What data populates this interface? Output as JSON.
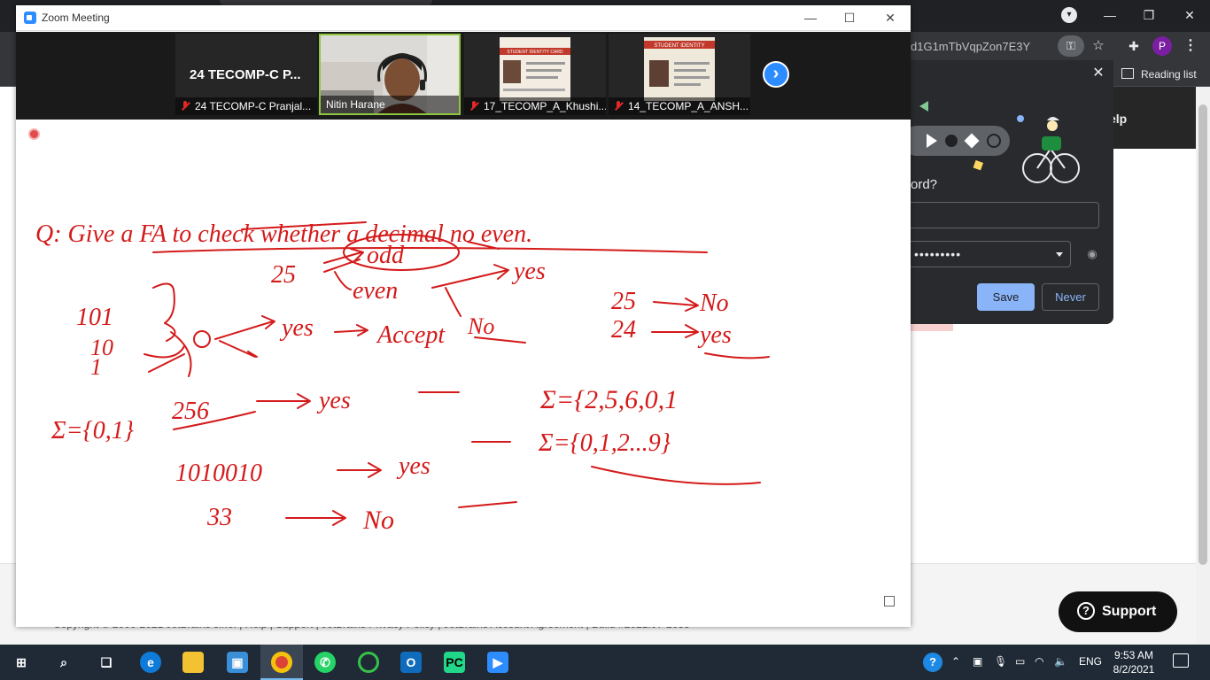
{
  "chrome": {
    "url_fragment": "d1G1mTbVqpZon7E3Y",
    "reading_list": "Reading list",
    "help_fragment": "elp",
    "avatar_letter": "P",
    "footer_text": "Copyright © 2000-2021 JetBrains s.r.o. | Help | Support | JetBrains Privacy Policy | JetBrains Account Agreement | Build #2021.07-2055"
  },
  "password_bubble": {
    "question_fragment": "ord?",
    "password_mask": "•••••••••",
    "save_label": "Save",
    "never_label": "Never"
  },
  "zoom": {
    "window_title": "Zoom Meeting",
    "tiles": [
      {
        "big_name": "24 TECOMP-C P...",
        "caption": "24 TECOMP-C Pranjal...",
        "muted": true,
        "kind": "name-only"
      },
      {
        "big_name": "",
        "caption": "Nitin Harane",
        "muted": false,
        "kind": "video-speaker"
      },
      {
        "big_name": "",
        "caption": "17_TECOMP_A_Khushi...",
        "muted": true,
        "kind": "id-card",
        "card_header": "STUDENT IDENTITY CARD"
      },
      {
        "big_name": "",
        "caption": "14_TECOMP_A_ANSH...",
        "muted": true,
        "kind": "id-card",
        "card_header": "STUDENT IDENTITY"
      }
    ]
  },
  "whiteboard": {
    "question": "Q: Give a FA to check whether a decimal no even.",
    "branch_odd": "odd",
    "branch_even": "even",
    "yes": "yes",
    "no": "No",
    "accept": "Accept",
    "examples_left": [
      "101",
      "10",
      "1"
    ],
    "sigma_left": "Σ={0,1}",
    "ex_256": "256",
    "ex_1010010": "1010010",
    "ex_33": "33",
    "ex_25": "25",
    "ex_24": "24",
    "sigma_right_1": "Σ={2,5,6,0,1",
    "sigma_right_2": "Σ={0,1,2...9}"
  },
  "support_label": "Support",
  "taskbar": {
    "apps": [
      "start",
      "search",
      "task-view",
      "edge",
      "file-explorer",
      "store",
      "chrome",
      "whatsapp",
      "spinner-app",
      "outlook",
      "pycharm",
      "zoom"
    ],
    "language": "ENG",
    "time": "9:53 AM",
    "date": "8/2/2021"
  },
  "colors": {
    "ink": "#d41a1a",
    "zoom_blue": "#2d8cff",
    "save_blue": "#8ab4f8",
    "taskbar": "#1f2a36"
  }
}
